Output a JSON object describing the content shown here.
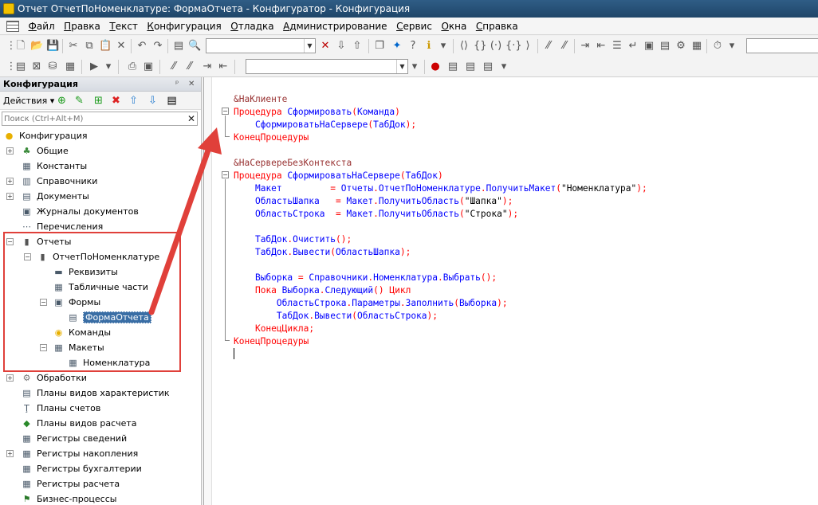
{
  "window": {
    "title": "Отчет ОтчетПоНоменклатуре: ФормаОтчета - Конфигуратор - Конфигурация"
  },
  "menu": [
    "Файл",
    "Правка",
    "Текст",
    "Конфигурация",
    "Отладка",
    "Администрирование",
    "Сервис",
    "Окна",
    "Справка"
  ],
  "panel": {
    "title": "Конфигурация",
    "pin_glyph": "ᵖ",
    "close_glyph": "✕",
    "actions_label": "Действия ▾",
    "search_placeholder": "Поиск (Ctrl+Alt+M)"
  },
  "tree": [
    {
      "label": "Конфигурация",
      "level": 0,
      "icon": "config-icon",
      "glyph": "●",
      "expander": ""
    },
    {
      "label": "Общие",
      "level": 1,
      "icon": "common-icon",
      "glyph": "♣",
      "expander": "+"
    },
    {
      "label": "Константы",
      "level": 1,
      "icon": "constants-icon",
      "glyph": "▦",
      "expander": ""
    },
    {
      "label": "Справочники",
      "level": 1,
      "icon": "catalogs-icon",
      "glyph": "▥",
      "expander": "+"
    },
    {
      "label": "Документы",
      "level": 1,
      "icon": "documents-icon",
      "glyph": "▤",
      "expander": "+"
    },
    {
      "label": "Журналы документов",
      "level": 1,
      "icon": "journals-icon",
      "glyph": "▣",
      "expander": ""
    },
    {
      "label": "Перечисления",
      "level": 1,
      "icon": "enums-icon",
      "glyph": "⋯",
      "expander": ""
    },
    {
      "label": "Отчеты",
      "level": 1,
      "icon": "reports-icon",
      "glyph": "▮",
      "expander": "−"
    },
    {
      "label": "ОтчетПоНоменклатуре",
      "level": 2,
      "icon": "report-icon",
      "glyph": "▮",
      "expander": "−"
    },
    {
      "label": "Реквизиты",
      "level": 3,
      "icon": "attributes-icon",
      "glyph": "▬",
      "expander": ""
    },
    {
      "label": "Табличные части",
      "level": 3,
      "icon": "tabular-icon",
      "glyph": "▦",
      "expander": ""
    },
    {
      "label": "Формы",
      "level": 3,
      "icon": "forms-icon",
      "glyph": "▣",
      "expander": "−"
    },
    {
      "label": "ФормаОтчета",
      "level": 4,
      "icon": "form-icon",
      "glyph": "▤",
      "expander": "",
      "selected": true
    },
    {
      "label": "Команды",
      "level": 3,
      "icon": "commands-icon",
      "glyph": "◉",
      "expander": ""
    },
    {
      "label": "Макеты",
      "level": 3,
      "icon": "templates-icon",
      "glyph": "▦",
      "expander": "−"
    },
    {
      "label": "Номенклатура",
      "level": 4,
      "icon": "template-icon",
      "glyph": "▦",
      "expander": ""
    },
    {
      "label": "Обработки",
      "level": 1,
      "icon": "dataprocessors-icon",
      "glyph": "⚙",
      "expander": "+"
    },
    {
      "label": "Планы видов характеристик",
      "level": 1,
      "icon": "chartofcharacteristics-icon",
      "glyph": "▤",
      "expander": ""
    },
    {
      "label": "Планы счетов",
      "level": 1,
      "icon": "chartofaccounts-icon",
      "glyph": "Ţ",
      "expander": ""
    },
    {
      "label": "Планы видов расчета",
      "level": 1,
      "icon": "chartofcalculation-icon",
      "glyph": "◆",
      "expander": ""
    },
    {
      "label": "Регистры сведений",
      "level": 1,
      "icon": "inforegisters-icon",
      "glyph": "▦",
      "expander": ""
    },
    {
      "label": "Регистры накопления",
      "level": 1,
      "icon": "accumregisters-icon",
      "glyph": "▦",
      "expander": "+"
    },
    {
      "label": "Регистры бухгалтерии",
      "level": 1,
      "icon": "accountingregisters-icon",
      "glyph": "▦",
      "expander": ""
    },
    {
      "label": "Регистры расчета",
      "level": 1,
      "icon": "calcregisters-icon",
      "glyph": "▦",
      "expander": ""
    },
    {
      "label": "Бизнес-процессы",
      "level": 1,
      "icon": "businessprocesses-icon",
      "glyph": "⚑",
      "expander": ""
    }
  ],
  "code": [
    [
      [
        "&НаКлиенте",
        "dir"
      ]
    ],
    [
      [
        "Процедура ",
        "kw"
      ],
      [
        "Сформировать",
        "id"
      ],
      [
        "(",
        "op"
      ],
      [
        "Команда",
        "id"
      ],
      [
        ")",
        "op"
      ]
    ],
    [
      [
        "    ",
        ""
      ],
      [
        "СформироватьНаСервере",
        "id"
      ],
      [
        "(",
        "op"
      ],
      [
        "ТабДок",
        "id"
      ],
      [
        ");",
        "op"
      ]
    ],
    [
      [
        "КонецПроцедуры",
        "kw"
      ]
    ],
    [
      [
        "",
        ""
      ]
    ],
    [
      [
        "&НаСервереБезКонтекста",
        "dir"
      ]
    ],
    [
      [
        "Процедура ",
        "kw"
      ],
      [
        "СформироватьНаСервере",
        "id"
      ],
      [
        "(",
        "op"
      ],
      [
        "ТабДок",
        "id"
      ],
      [
        ")",
        "op"
      ]
    ],
    [
      [
        "    ",
        ""
      ],
      [
        "Макет",
        "id"
      ],
      [
        "         = ",
        "op"
      ],
      [
        "Отчеты",
        "id"
      ],
      [
        ".",
        "op"
      ],
      [
        "ОтчетПоНоменклатуре",
        "id"
      ],
      [
        ".",
        "op"
      ],
      [
        "ПолучитьМакет",
        "id"
      ],
      [
        "(",
        "op"
      ],
      [
        "\"Номенклатура\"",
        "str"
      ],
      [
        ");",
        "op"
      ]
    ],
    [
      [
        "    ",
        ""
      ],
      [
        "ОбластьШапка",
        "id"
      ],
      [
        "   = ",
        "op"
      ],
      [
        "Макет",
        "id"
      ],
      [
        ".",
        "op"
      ],
      [
        "ПолучитьОбласть",
        "id"
      ],
      [
        "(",
        "op"
      ],
      [
        "\"Шапка\"",
        "str"
      ],
      [
        ");",
        "op"
      ]
    ],
    [
      [
        "    ",
        ""
      ],
      [
        "ОбластьСтрока",
        "id"
      ],
      [
        "  = ",
        "op"
      ],
      [
        "Макет",
        "id"
      ],
      [
        ".",
        "op"
      ],
      [
        "ПолучитьОбласть",
        "id"
      ],
      [
        "(",
        "op"
      ],
      [
        "\"Строка\"",
        "str"
      ],
      [
        ");",
        "op"
      ]
    ],
    [
      [
        "",
        ""
      ]
    ],
    [
      [
        "    ",
        ""
      ],
      [
        "ТабДок",
        "id"
      ],
      [
        ".",
        "op"
      ],
      [
        "Очистить",
        "id"
      ],
      [
        "();",
        "op"
      ]
    ],
    [
      [
        "    ",
        ""
      ],
      [
        "ТабДок",
        "id"
      ],
      [
        ".",
        "op"
      ],
      [
        "Вывести",
        "id"
      ],
      [
        "(",
        "op"
      ],
      [
        "ОбластьШапка",
        "id"
      ],
      [
        ");",
        "op"
      ]
    ],
    [
      [
        "",
        ""
      ]
    ],
    [
      [
        "    ",
        ""
      ],
      [
        "Выборка",
        "id"
      ],
      [
        " = ",
        "op"
      ],
      [
        "Справочники",
        "id"
      ],
      [
        ".",
        "op"
      ],
      [
        "Номенклатура",
        "id"
      ],
      [
        ".",
        "op"
      ],
      [
        "Выбрать",
        "id"
      ],
      [
        "();",
        "op"
      ]
    ],
    [
      [
        "    ",
        ""
      ],
      [
        "Пока ",
        "kw"
      ],
      [
        "Выборка",
        "id"
      ],
      [
        ".",
        "op"
      ],
      [
        "Следующий",
        "id"
      ],
      [
        "() ",
        "op"
      ],
      [
        "Цикл",
        "kw"
      ]
    ],
    [
      [
        "        ",
        ""
      ],
      [
        "ОбластьСтрока",
        "id"
      ],
      [
        ".",
        "op"
      ],
      [
        "Параметры",
        "id"
      ],
      [
        ".",
        "op"
      ],
      [
        "Заполнить",
        "id"
      ],
      [
        "(",
        "op"
      ],
      [
        "Выборка",
        "id"
      ],
      [
        ");",
        "op"
      ]
    ],
    [
      [
        "        ",
        ""
      ],
      [
        "ТабДок",
        "id"
      ],
      [
        ".",
        "op"
      ],
      [
        "Вывести",
        "id"
      ],
      [
        "(",
        "op"
      ],
      [
        "ОбластьСтрока",
        "id"
      ],
      [
        ");",
        "op"
      ]
    ],
    [
      [
        "    ",
        ""
      ],
      [
        "КонецЦикла",
        "kw"
      ],
      [
        ";",
        "op"
      ]
    ],
    [
      [
        "КонецПроцедуры",
        "kw"
      ]
    ]
  ],
  "colors": {
    "annotation": "#e0403a",
    "keyword": "#ff0000",
    "identifier": "#0000ff"
  }
}
